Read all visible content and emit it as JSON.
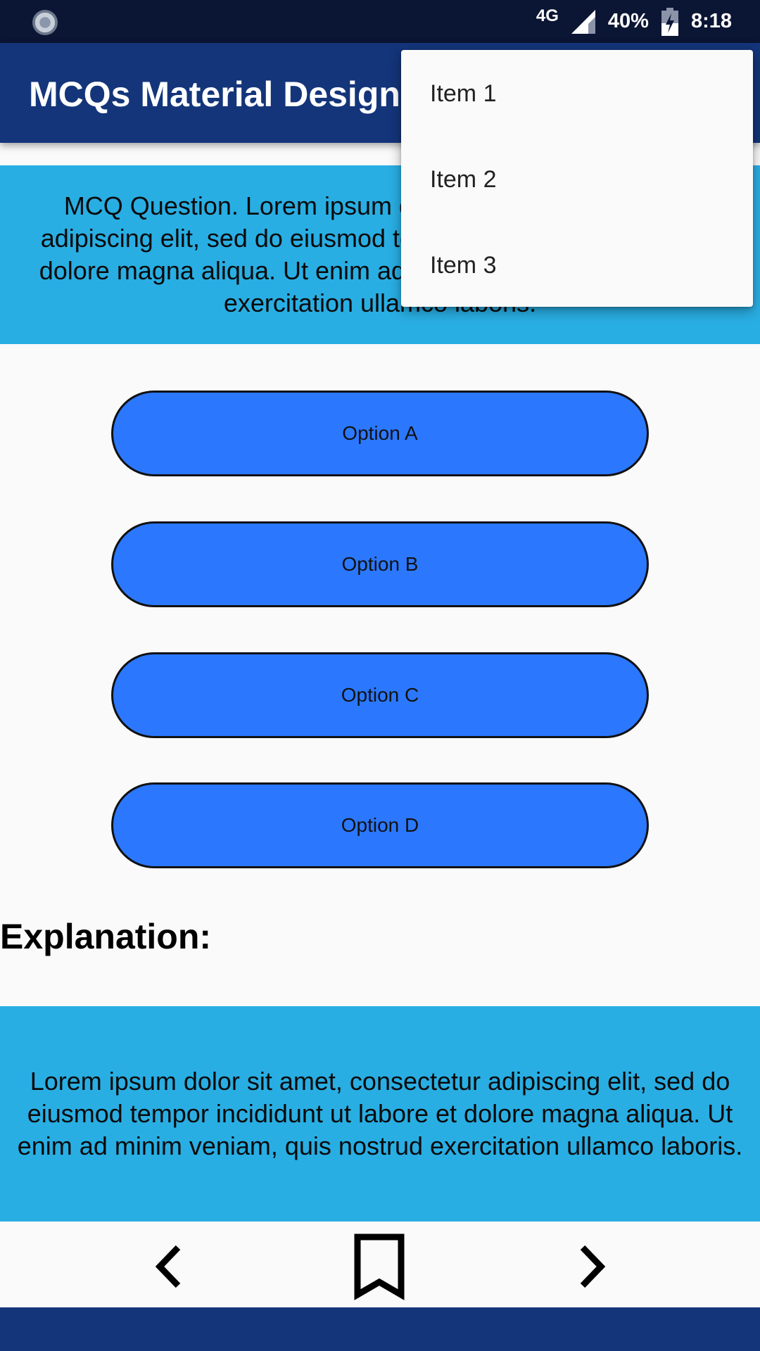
{
  "status_bar": {
    "network": "4G",
    "battery": "40%",
    "time": "8:18"
  },
  "app_bar": {
    "title": "MCQs Material Design"
  },
  "question": {
    "text": "MCQ Question. Lorem ipsum dolor sit amet, consectetur adipiscing elit, sed do eiusmod tempor incididunt ut labore et dolore magna aliqua. Ut enim ad minim veniam, quis nostrud exercitation ullamco laboris."
  },
  "options": [
    "Option A",
    "Option B",
    "Option C",
    "Option D"
  ],
  "explanation": {
    "heading": "Explanation:",
    "text": "Lorem ipsum dolor sit amet, consectetur adipiscing elit, sed do eiusmod tempor incididunt ut labore et dolore magna aliqua. Ut enim ad minim veniam, quis nostrud exercitation ullamco laboris."
  },
  "nav": {
    "prev_icon": "chevron-left-icon",
    "bookmark_icon": "bookmark-icon",
    "next_icon": "chevron-right-icon"
  },
  "menu": {
    "items": [
      "Item 1",
      "Item 2",
      "Item 3"
    ]
  },
  "colors": {
    "status_bar": "#0b1534",
    "app_bar": "#14357a",
    "panel": "#29aee3",
    "option": "#2b78ff"
  }
}
